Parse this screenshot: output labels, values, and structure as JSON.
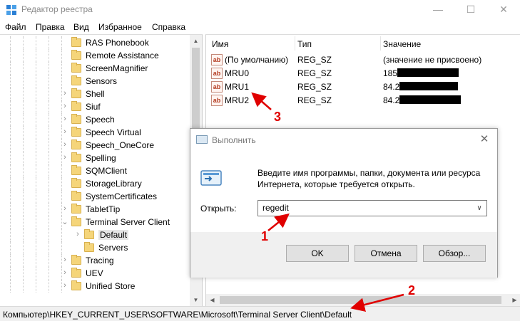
{
  "window": {
    "title": "Редактор реестра",
    "controls": {
      "minimize": "—",
      "maximize": "☐",
      "close": "✕"
    }
  },
  "menu": [
    "Файл",
    "Правка",
    "Вид",
    "Избранное",
    "Справка"
  ],
  "tree": {
    "items": [
      {
        "label": "RAS Phonebook"
      },
      {
        "label": "Remote Assistance"
      },
      {
        "label": "ScreenMagnifier"
      },
      {
        "label": "Sensors"
      },
      {
        "label": "Shell"
      },
      {
        "label": "Siuf"
      },
      {
        "label": "Speech"
      },
      {
        "label": "Speech Virtual"
      },
      {
        "label": "Speech_OneCore"
      },
      {
        "label": "Spelling"
      },
      {
        "label": "SQMClient"
      },
      {
        "label": "StorageLibrary"
      },
      {
        "label": "SystemCertificates"
      },
      {
        "label": "TabletTip"
      },
      {
        "label": "Terminal Server Client"
      },
      {
        "label": "Default"
      },
      {
        "label": "Servers"
      },
      {
        "label": "Tracing"
      },
      {
        "label": "UEV"
      },
      {
        "label": "Unified Store"
      }
    ]
  },
  "values_panel": {
    "headers": {
      "name": "Имя",
      "type": "Тип",
      "data": "Значение"
    },
    "rows": [
      {
        "name": "(По умолчанию)",
        "type": "REG_SZ",
        "data": "(значение не присвоено)"
      },
      {
        "name": "MRU0",
        "type": "REG_SZ",
        "data": "185"
      },
      {
        "name": "MRU1",
        "type": "REG_SZ",
        "data": "84.2"
      },
      {
        "name": "MRU2",
        "type": "REG_SZ",
        "data": "84.2"
      }
    ]
  },
  "statusbar": {
    "path": "Компьютер\\HKEY_CURRENT_USER\\SOFTWARE\\Microsoft\\Terminal Server Client\\Default"
  },
  "run_dialog": {
    "title": "Выполнить",
    "description": "Введите имя программы, папки, документа или ресурса Интернета, которые требуется открыть.",
    "open_label": "Открыть:",
    "input_value": "regedit",
    "buttons": {
      "ok": "OK",
      "cancel": "Отмена",
      "browse": "Обзор..."
    }
  },
  "annotations": {
    "n1": "1",
    "n2": "2",
    "n3": "3"
  },
  "colors": {
    "annotation": "#e00000",
    "selection": "#e5e5e5",
    "folder": "#f5d57a"
  }
}
